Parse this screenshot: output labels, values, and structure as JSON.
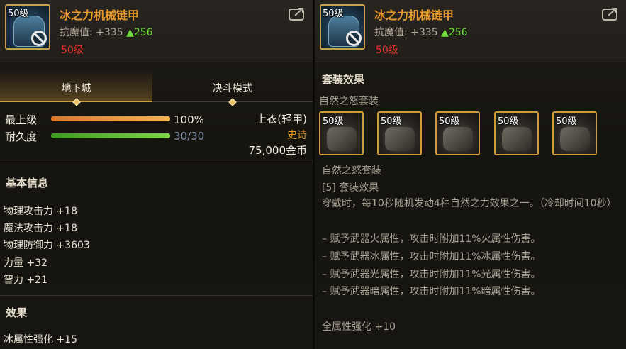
{
  "left": {
    "header": {
      "icon_level": "50级",
      "name": "冰之力机械链甲",
      "resist_label": "抗魔值: +335",
      "resist_delta": "▲256",
      "required_level": "50级"
    },
    "tabs": [
      {
        "label": "地下城"
      },
      {
        "label": "决斗模式"
      }
    ],
    "stats": {
      "upgrade_label": "最上级",
      "upgrade_value": "100%",
      "upgrade_fraction": 1.0,
      "durability_label": "耐久度",
      "durability_value": "30/30",
      "durability_fraction": 1.0,
      "slot_type": "上衣(轻甲)",
      "rarity": "史诗",
      "price": "75,000金币"
    },
    "basic_info": {
      "title": "基本信息",
      "lines": [
        "物理攻击力 +18",
        "魔法攻击力 +18",
        "物理防御力 +3603",
        "力量 +32",
        "智力 +21"
      ]
    },
    "effects": {
      "title": "效果",
      "lines": [
        "冰属性强化 +15"
      ]
    }
  },
  "right": {
    "header": {
      "icon_level": "50级",
      "name": "冰之力机械链甲",
      "resist_label": "抗魔值: +335",
      "resist_delta": "▲256",
      "required_level": "50级"
    },
    "set": {
      "title": "套装效果",
      "subtitle": "自然之怒套装",
      "items": [
        {
          "level": "50级"
        },
        {
          "level": "50级"
        },
        {
          "level": "50级"
        },
        {
          "level": "50级"
        },
        {
          "level": "50级"
        }
      ],
      "desc_name": "自然之怒套装",
      "desc_count": "[5] 套装效果",
      "desc_main": "穿戴时，每10秒随机发动4种自然之力效果之一。（冷却时间10秒）",
      "effects": [
        "– 赋予武器火属性，攻击时附加11%火属性伤害。",
        "– 赋予武器冰属性，攻击时附加11%冰属性伤害。",
        "– 赋予武器光属性，攻击时附加11%光属性伤害。",
        "– 赋予武器暗属性，攻击时附加11%暗属性伤害。"
      ],
      "bonus": "全属性强化 +10"
    }
  },
  "colors": {
    "name": "#e89a2a",
    "delta_up": "#6fdc3a",
    "required_level": "#e8332c",
    "rarity_epic": "#e2a01e",
    "frame_gold": "#c9a04a"
  }
}
